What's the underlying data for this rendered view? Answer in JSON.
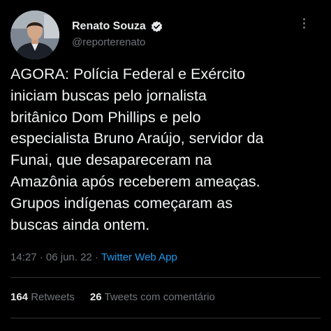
{
  "tweet": {
    "author": {
      "name": "Renato Souza",
      "handle": "@reporterenato",
      "verified": true
    },
    "body_lines": [
      "AGORA: Polícia Federal e Exército",
      "iniciam buscas pelo jornalista",
      "britânico Dom Phillips e pelo",
      "especialista Bruno Araújo, servidor da",
      "Funai, que desapareceram na",
      "Amazônia após receberem ameaças.",
      "Grupos indígenas começaram as",
      "buscas ainda ontem."
    ],
    "time": "14:27",
    "separator": "·",
    "date": "06 jun. 22",
    "source": "Twitter Web App",
    "stats": {
      "retweets_count": "164",
      "retweets_label": "Retweets",
      "quotes_count": "26",
      "quotes_label": "Tweets com comentário"
    }
  },
  "colors": {
    "background": "#000000",
    "text_primary": "#e7e9ea",
    "text_secondary": "#71767b",
    "link": "#1d9bf0",
    "divider": "#2f3336"
  },
  "icons": {
    "verified": "verified-badge-icon",
    "more": "more-options-icon"
  }
}
